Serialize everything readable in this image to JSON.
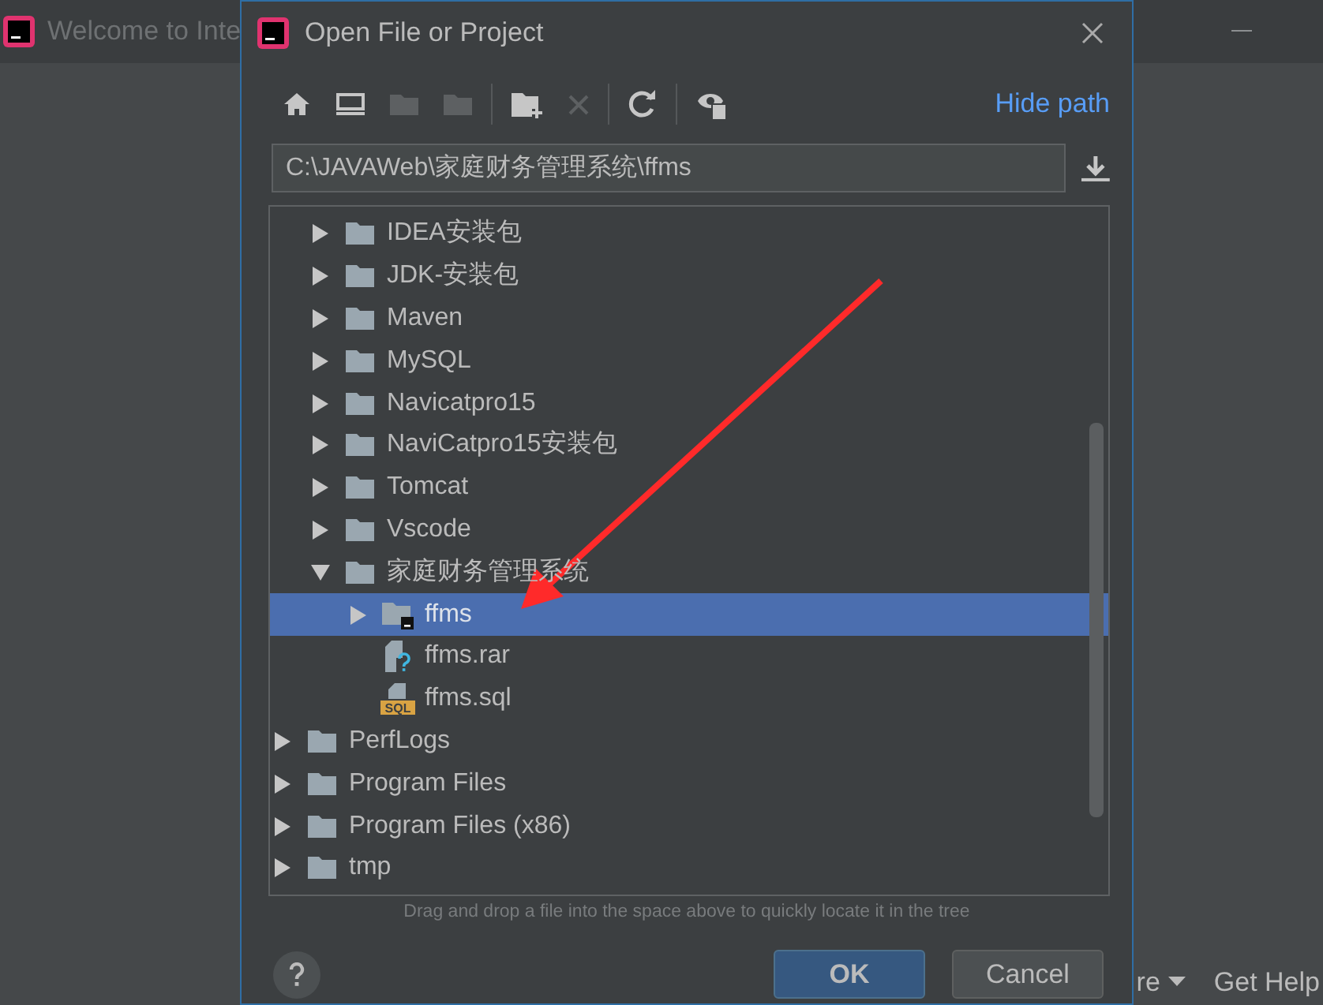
{
  "background_window": {
    "title": "Welcome to Inte",
    "footer_links": [
      {
        "label": "re",
        "dropdown": true
      },
      {
        "label": "Get Help",
        "dropdown": false
      }
    ]
  },
  "dialog": {
    "title": "Open File or Project",
    "hide_path_link": "Hide path",
    "path": "C:\\JAVAWeb\\家庭财务管理系统\\ffms",
    "tree": [
      {
        "children": [
          {
            "label": "IDEA安装包",
            "kind": "folder",
            "expanded": false,
            "selected": false
          },
          {
            "label": "JDK-安装包",
            "kind": "folder",
            "expanded": false,
            "selected": false
          },
          {
            "label": "Maven",
            "kind": "folder",
            "expanded": false,
            "selected": false
          },
          {
            "label": "MySQL",
            "kind": "folder",
            "expanded": false,
            "selected": false
          },
          {
            "label": "Navicatpro15",
            "kind": "folder",
            "expanded": false,
            "selected": false
          },
          {
            "label": "NaviCatpro15安装包",
            "kind": "folder",
            "expanded": false,
            "selected": false
          },
          {
            "label": "Tomcat",
            "kind": "folder",
            "expanded": false,
            "selected": false
          },
          {
            "label": "Vscode",
            "kind": "folder",
            "expanded": false,
            "selected": false
          },
          {
            "label": "家庭财务管理系统",
            "kind": "folder",
            "expanded": true,
            "selected": false,
            "children": [
              {
                "label": "ffms",
                "kind": "project",
                "expanded": false,
                "selected": true
              },
              {
                "label": "ffms.rar",
                "kind": "unknown_file",
                "selected": false
              },
              {
                "label": "ffms.sql",
                "kind": "sql_file",
                "icon_text": "SQL",
                "selected": false
              }
            ]
          }
        ]
      },
      {
        "label": "PerfLogs",
        "kind": "folder",
        "expanded": false,
        "selected": false
      },
      {
        "label": "Program Files",
        "kind": "folder",
        "expanded": false,
        "selected": false
      },
      {
        "label": "Program Files (x86)",
        "kind": "folder",
        "expanded": false,
        "selected": false
      },
      {
        "label": "tmp",
        "kind": "folder",
        "expanded": false,
        "selected": false
      }
    ],
    "hint": "Drag and drop a file into the space above to quickly locate it in the tree",
    "buttons": [
      {
        "label": "OK",
        "default": true
      },
      {
        "label": "Cancel",
        "default": false
      }
    ]
  }
}
